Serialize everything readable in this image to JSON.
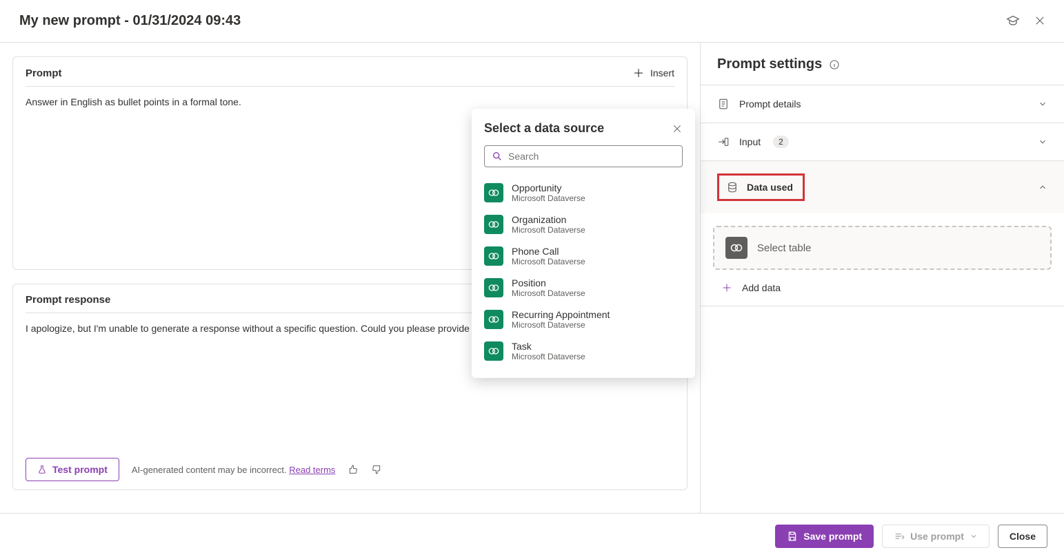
{
  "header": {
    "title": "My new prompt - 01/31/2024 09:43"
  },
  "prompt": {
    "title": "Prompt",
    "insert_label": "Insert",
    "text": "Answer in English as bullet points in a formal tone."
  },
  "response": {
    "title": "Prompt response",
    "text": "I apologize, but I'm unable to generate a response without a specific question. Could you please provide",
    "test_label": "Test prompt",
    "disclaimer": "AI-generated content may be incorrect.",
    "read_terms": "Read terms"
  },
  "settings": {
    "title": "Prompt settings",
    "details_label": "Prompt details",
    "input_label": "Input",
    "input_count": "2",
    "data_used_label": "Data used",
    "select_table_label": "Select table",
    "add_data_label": "Add data"
  },
  "popover": {
    "title": "Select a data source",
    "search_placeholder": "Search",
    "items": [
      {
        "name": "Opportunity",
        "sub": "Microsoft Dataverse"
      },
      {
        "name": "Organization",
        "sub": "Microsoft Dataverse"
      },
      {
        "name": "Phone Call",
        "sub": "Microsoft Dataverse"
      },
      {
        "name": "Position",
        "sub": "Microsoft Dataverse"
      },
      {
        "name": "Recurring Appointment",
        "sub": "Microsoft Dataverse"
      },
      {
        "name": "Task",
        "sub": "Microsoft Dataverse"
      }
    ]
  },
  "footer": {
    "save_label": "Save prompt",
    "use_label": "Use prompt",
    "close_label": "Close"
  }
}
